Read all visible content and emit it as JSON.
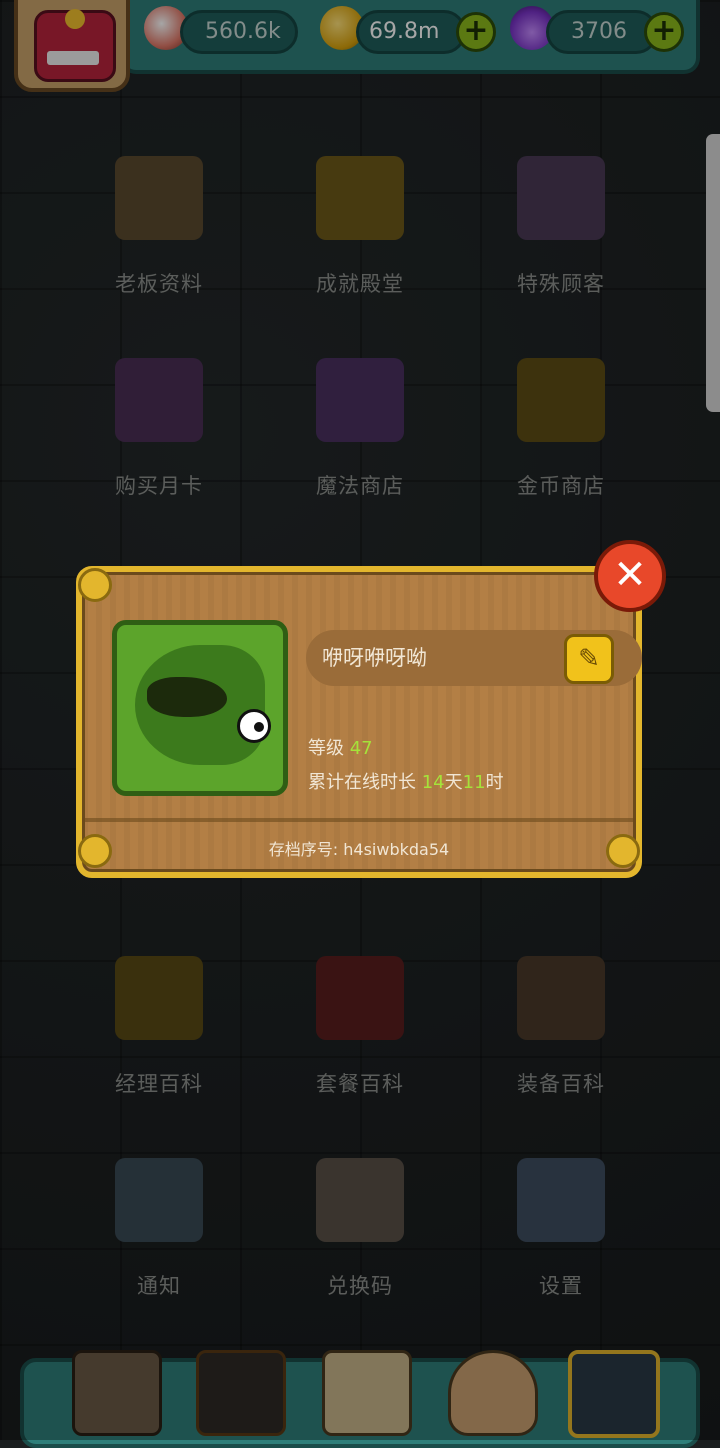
{
  "resources": {
    "eyes": "560.6k",
    "gold": "69.8m",
    "potion": "3706",
    "plus": "+"
  },
  "grid": [
    {
      "label": "老板资料",
      "icon": "boss-card-icon",
      "color": "#5b4a2e"
    },
    {
      "label": "成就殿堂",
      "icon": "trophy-icon",
      "color": "#6e5a1a"
    },
    {
      "label": "特殊顾客",
      "icon": "special-customer-icon",
      "color": "#4a3a55"
    },
    {
      "label": "购买月卡",
      "icon": "monthly-card-icon",
      "color": "#4a2f55"
    },
    {
      "label": "魔法商店",
      "icon": "magic-potion-icon",
      "color": "#4a3060"
    },
    {
      "label": "金币商店",
      "icon": "gold-coins-icon",
      "color": "#5e4e15"
    },
    {
      "label": "经理百科",
      "icon": "manager-book-icon",
      "color": "#5a4a14"
    },
    {
      "label": "套餐百科",
      "icon": "meal-book-icon",
      "color": "#5a1e1e"
    },
    {
      "label": "装备百科",
      "icon": "equipment-book-icon",
      "color": "#4a3a2a"
    },
    {
      "label": "通知",
      "icon": "horn-icon",
      "color": "#3a4a55"
    },
    {
      "label": "兑换码",
      "icon": "scroll-code-icon",
      "color": "#5a5048"
    },
    {
      "label": "设置",
      "icon": "gear-icon",
      "color": "#3e4e60"
    }
  ],
  "popup": {
    "player_name": "咿呀咿呀呦",
    "edit_icon": "✎",
    "level_label": "等级 ",
    "level_value": "47",
    "online_label": "累计在线时长 ",
    "online_days": "14",
    "days_unit": "天",
    "online_hours": "11",
    "hours_unit": "时",
    "save_id": "存档序号: h4siwbkda54",
    "close_icon": "✕"
  }
}
